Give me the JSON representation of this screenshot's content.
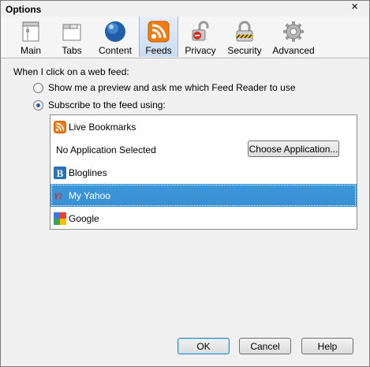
{
  "window": {
    "title": "Options",
    "close_glyph": "×"
  },
  "tabs": [
    {
      "label": "Main",
      "icon": "main-icon"
    },
    {
      "label": "Tabs",
      "icon": "tabs-icon"
    },
    {
      "label": "Content",
      "icon": "content-globe-icon"
    },
    {
      "label": "Feeds",
      "icon": "feed-icon",
      "selected": true
    },
    {
      "label": "Privacy",
      "icon": "privacy-lock-icon"
    },
    {
      "label": "Security",
      "icon": "security-padlock-icon"
    },
    {
      "label": "Advanced",
      "icon": "gear-icon"
    }
  ],
  "feeds": {
    "heading": "When I click on a web feed:",
    "option_preview": "Show me a preview and ask me which Feed Reader to use",
    "option_subscribe": "Subscribe to the feed using:",
    "selected_option": "subscribe",
    "readers": [
      {
        "label": "Live Bookmarks",
        "icon": "live-bookmarks-feed-icon"
      },
      {
        "label": "No Application Selected",
        "icon": ""
      },
      {
        "label": "Bloglines",
        "icon": "bloglines-icon"
      },
      {
        "label": "My Yahoo",
        "icon": "yahoo-icon",
        "selected": true
      },
      {
        "label": "Google",
        "icon": "google-icon"
      }
    ],
    "choose_application": "Choose Application..."
  },
  "buttons": {
    "ok": "OK",
    "cancel": "Cancel",
    "help": "Help"
  },
  "colors": {
    "selection": "#3a8fd3",
    "feed_orange": "#f07d12"
  }
}
